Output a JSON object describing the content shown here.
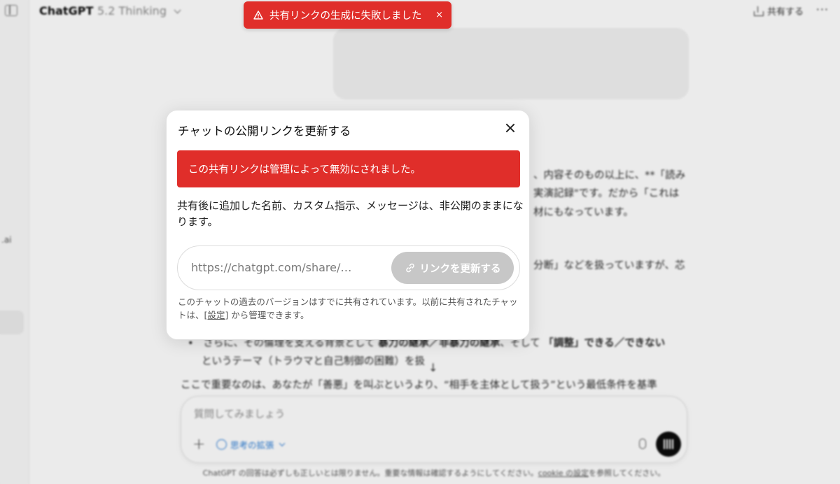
{
  "app": {
    "model_name": "ChatGPT",
    "model_version": "5.2 Thinking",
    "share_label": "共有する",
    "more_label": "···",
    "sidebar_fragment": ".ai"
  },
  "toast": {
    "message": "共有リンクの生成に失敗しました",
    "close": "×"
  },
  "conversation": {
    "lines": [
      "、内容そのもの以上に、**「読み",
      "実演記録\"です。だから「これは",
      "材にもなっています。",
      "分断」などを扱っていますが、芯",
      "ここで重要なのは、あなたが「善悪」を叫ぶというより、“相手を主体として扱う”という最低条件を基準"
    ],
    "bullet_line1_a": "さらに、その倫理を支える背景として ",
    "bullet_line1_b": "暴力の継承／非暴力の継承",
    "bullet_line1_c": "、そして ",
    "bullet_line1_d": "「調整」できる／できない",
    "bullet_line2": "というテーマ（トラウマと自己制御の困難）を扱"
  },
  "composer": {
    "placeholder": "質問してみましょう",
    "plus": "+",
    "think_label": "思考の拡張",
    "scroll_down": "↓"
  },
  "footer": {
    "text_a": "ChatGPT の回答は必ずしも正しいとは限りません。重要な情報は確認するようにしてください。",
    "link": "cookie の設定",
    "text_b": "を参照してください。"
  },
  "modal": {
    "title": "チャットの公開リンクを更新する",
    "alert": "この共有リンクは管理によって無効にされました。",
    "description": "共有後に追加した名前、カスタム指示、メッセージは、非公開のままになります。",
    "url": "https://chatgpt.com/share/…",
    "update_button": "リンクを更新する",
    "note_a": "このチャットの過去のバージョンはすでに共有されています。以前に共有されたチャットは、",
    "note_link": "[設定]",
    "note_b": " から管理できます。"
  },
  "colors": {
    "error_red": "#e02e2a",
    "disabled_button": "#c7c7c7",
    "accent_blue": "#2f7fd6"
  }
}
